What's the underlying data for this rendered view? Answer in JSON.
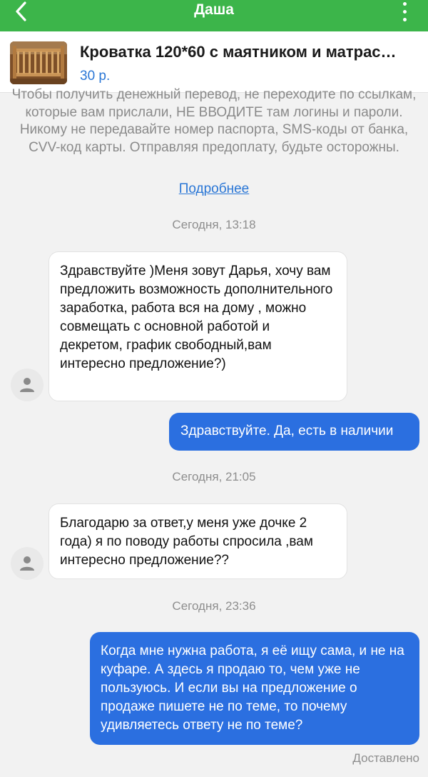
{
  "header": {
    "title": "Даша",
    "back_icon": "chevron-left-icon",
    "menu_icon": "more-vertical-icon",
    "color": "#3cb54a"
  },
  "product": {
    "title": "Кроватка 120*60 с маятником и матрас…",
    "price": "30 р."
  },
  "notice": {
    "text": "Чтобы получить денежный перевод, не переходите по ссылкам, которые вам прислали, НЕ ВВОДИТЕ там логины и пароли. Никому не передавайте номер паспорта, SMS-коды от банка, CVV-код карты. Отправляя предоплату, будьте осторожны.",
    "link": "Подробнее"
  },
  "messages": [
    {
      "type": "date",
      "text": "Сегодня, 13:18"
    },
    {
      "type": "in",
      "text": "Здравствуйте )Меня зовут Дарья, хочу вам предложить возможность дополнительного заработка, работа вся на дому , можно совмещать с основной работой и декретом, график свободный,вам интересно предложение?)"
    },
    {
      "type": "out",
      "text": "Здравствуйте. Да, есть в наличии"
    },
    {
      "type": "date",
      "text": "Сегодня, 21:05"
    },
    {
      "type": "in",
      "text": "Благодарю за ответ,у меня уже дочке 2 года) я по поводу работы спросила ,вам интересно предложение??"
    },
    {
      "type": "date",
      "text": "Сегодня, 23:36"
    },
    {
      "type": "out",
      "text": "Когда мне нужна работа, я её ищу сама, и не на куфаре. А здесь я продаю то, чем уже не пользуюсь. И если вы на предложение о продаже пишете не по теме, то почему удивляетесь ответу не по теме?"
    }
  ],
  "status": "Доставлено",
  "colors": {
    "accent": "#3cb54a",
    "outgoing_bubble": "#2b6fe0",
    "link": "#2b77d6"
  }
}
